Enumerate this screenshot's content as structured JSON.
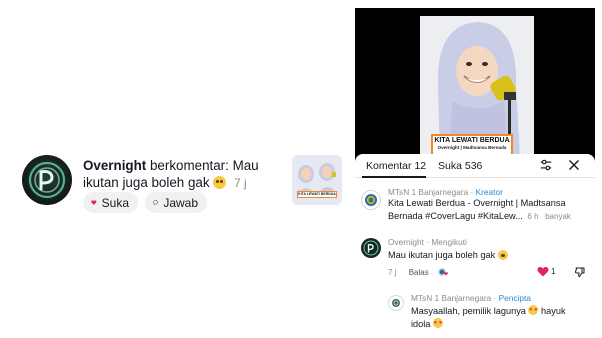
{
  "notification": {
    "username": "Overnight",
    "action": " berkomentar: Mau ikutan juga boleh gak",
    "time": "7 j",
    "like_label": "Suka",
    "reply_label": "Jawab"
  },
  "video": {
    "title": "KITA LEWATI BERDUA",
    "subtitle": "Overnight | Madtsansa Bernada"
  },
  "comments_sheet": {
    "tab_comments": "Komentar 12",
    "tab_likes": "Suka 536",
    "creator_post": {
      "author": "MTsN 1 Banjarnegara",
      "sep": " · ",
      "badge": "Kreator",
      "text": "Kita Lewati Berdua - Overnight  | Madtsansa Bernada #CoverLagu #KitaLew...",
      "time": "6 h",
      "more": "banyak"
    },
    "comment": {
      "author": "Overnight",
      "sep": " · ",
      "badge": "Mengikuti",
      "text": "Mau ikutan juga boleh gak",
      "time": "7 j",
      "reply_label": "Balas",
      "like_count": "1"
    },
    "reply": {
      "author": "MTsN 1 Banjarnegara",
      "sep": " · ",
      "badge": "Pencipta",
      "text": "Masyaallah, pemilik lagunya",
      "text2": " hayuk idola"
    }
  },
  "colors": {
    "like_red": "#e0245e",
    "badge_blue": "#2a8ad3",
    "title_border": "#f08a24"
  }
}
